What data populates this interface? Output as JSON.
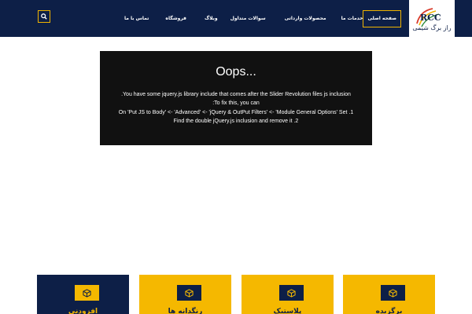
{
  "header": {
    "logo_text": "راز برگ شیمی",
    "logo_mark": "RCC",
    "nav": [
      {
        "label": "صفحه اصلی",
        "active": true
      },
      {
        "label": "خدمات ما",
        "active": false
      },
      {
        "label": "محصولات وارداتی",
        "active": false
      },
      {
        "label": "سوالات متداول",
        "active": false
      },
      {
        "label": "وبلاگ",
        "active": false
      },
      {
        "label": "فروشگاه",
        "active": false
      },
      {
        "label": "تماس با ما",
        "active": false
      }
    ],
    "search_icon": "search-icon"
  },
  "error_box": {
    "title": "Oops...",
    "line1": "You have some jquery.js library include that comes after the Slider Revolution files js inclusion.",
    "line2": "To fix this, you can:",
    "line3": "1. On 'Put JS to Body' <- 'Advanced' <- 'jQuery & OutPut Filters' <- 'Module General Options' Set",
    "line4": "2. Find the double jQuery.js inclusion and remove it"
  },
  "cards": [
    {
      "label": "افزودنی",
      "icon": "box-icon"
    },
    {
      "label": "رنگدانه ها",
      "icon": "box-icon"
    },
    {
      "label": "پلاستیک",
      "icon": "box-icon"
    },
    {
      "label": "برگزیده",
      "icon": "box-icon"
    }
  ],
  "colors": {
    "navy": "#0d1f47",
    "gold": "#f5b800",
    "error_bg": "#111111"
  }
}
